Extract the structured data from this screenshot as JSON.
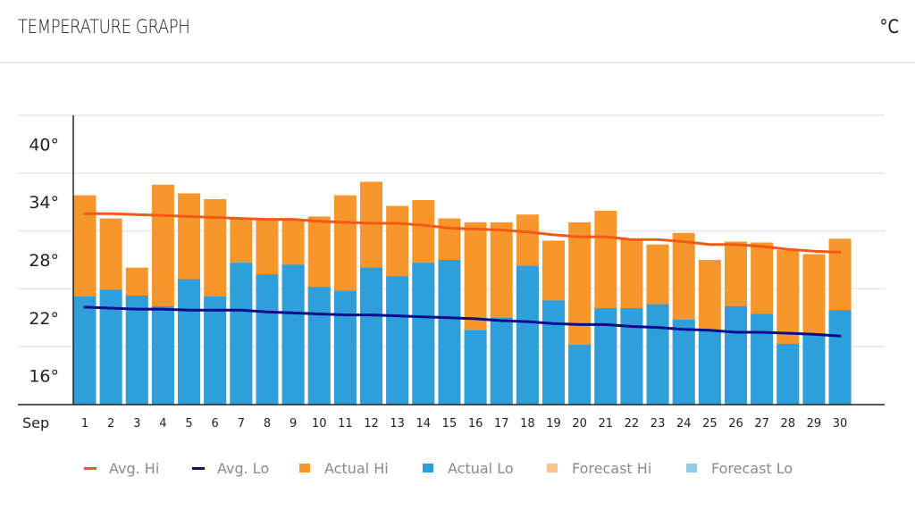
{
  "header": {
    "title": "TEMPERATURE GRAPH",
    "unit_toggle": "°C"
  },
  "colors": {
    "avg_hi": "#f05a16",
    "avg_lo": "#0b0c8c",
    "actual_hi": "#f7962a",
    "actual_lo": "#2e9fda",
    "forecast_hi": "#fbc38f",
    "forecast_lo": "#90cbec",
    "gridline": "#e4e4e4",
    "axis": "#222222"
  },
  "chart_data": {
    "type": "bar",
    "title": "TEMPERATURE GRAPH",
    "xlabel": "Sep",
    "ylabel": "°C",
    "month_label": "Sep",
    "ylim": [
      13,
      43
    ],
    "y_gridlines": [
      13,
      19,
      25,
      31,
      37,
      43
    ],
    "y_ticks": [
      16,
      22,
      28,
      34,
      40
    ],
    "y_tick_labels": [
      "16°",
      "22°",
      "28°",
      "34°",
      "40°"
    ],
    "grid": true,
    "legend_position": "bottom",
    "categories": [
      "1",
      "2",
      "3",
      "4",
      "5",
      "6",
      "7",
      "8",
      "9",
      "10",
      "11",
      "12",
      "13",
      "14",
      "15",
      "16",
      "17",
      "18",
      "19",
      "20",
      "21",
      "22",
      "23",
      "24",
      "25",
      "26",
      "27",
      "28",
      "29",
      "30"
    ],
    "series": [
      {
        "name": "Actual Hi",
        "kind": "bar",
        "color_key": "actual_hi",
        "values": [
          34.7,
          32.3,
          27.2,
          35.8,
          34.9,
          34.3,
          32.4,
          32.2,
          32.2,
          32.5,
          34.7,
          36.1,
          33.6,
          34.2,
          32.3,
          31.9,
          31.9,
          32.7,
          30.0,
          31.9,
          33.1,
          30.2,
          29.6,
          30.8,
          28.0,
          29.9,
          29.8,
          29.0,
          28.6,
          30.2
        ]
      },
      {
        "name": "Actual Lo",
        "kind": "bar",
        "color_key": "actual_lo",
        "values": [
          24.2,
          24.9,
          24.3,
          23.2,
          26.0,
          24.2,
          27.7,
          26.5,
          27.5,
          25.2,
          24.8,
          27.2,
          26.3,
          27.7,
          28.0,
          20.7,
          22.0,
          27.4,
          23.8,
          19.2,
          23.0,
          23.0,
          23.4,
          21.8,
          20.8,
          23.2,
          22.4,
          19.3,
          20.4,
          22.8
        ]
      },
      {
        "name": "Avg. Hi",
        "kind": "line",
        "color_key": "avg_hi",
        "values": [
          32.8,
          32.8,
          32.7,
          32.6,
          32.5,
          32.4,
          32.3,
          32.2,
          32.2,
          32.0,
          31.9,
          31.8,
          31.8,
          31.6,
          31.3,
          31.2,
          31.1,
          30.9,
          30.6,
          30.4,
          30.4,
          30.1,
          30.1,
          29.9,
          29.6,
          29.6,
          29.4,
          29.1,
          28.9,
          28.8
        ]
      },
      {
        "name": "Avg. Lo",
        "kind": "line",
        "color_key": "avg_lo",
        "values": [
          23.1,
          23.0,
          22.9,
          22.9,
          22.8,
          22.8,
          22.8,
          22.6,
          22.5,
          22.4,
          22.3,
          22.3,
          22.2,
          22.1,
          22.0,
          21.9,
          21.7,
          21.6,
          21.4,
          21.3,
          21.3,
          21.1,
          21.0,
          20.8,
          20.7,
          20.5,
          20.5,
          20.4,
          20.3,
          20.1
        ]
      }
    ],
    "legend": [
      {
        "label": "Avg. Hi",
        "marker": "line",
        "color_key": "avg_hi"
      },
      {
        "label": "Avg. Lo",
        "marker": "line",
        "color_key": "avg_lo"
      },
      {
        "label": "Actual Hi",
        "marker": "box",
        "color_key": "actual_hi"
      },
      {
        "label": "Actual Lo",
        "marker": "box",
        "color_key": "actual_lo"
      },
      {
        "label": "Forecast Hi",
        "marker": "box",
        "color_key": "forecast_hi"
      },
      {
        "label": "Forecast Lo",
        "marker": "box",
        "color_key": "forecast_lo"
      }
    ]
  }
}
